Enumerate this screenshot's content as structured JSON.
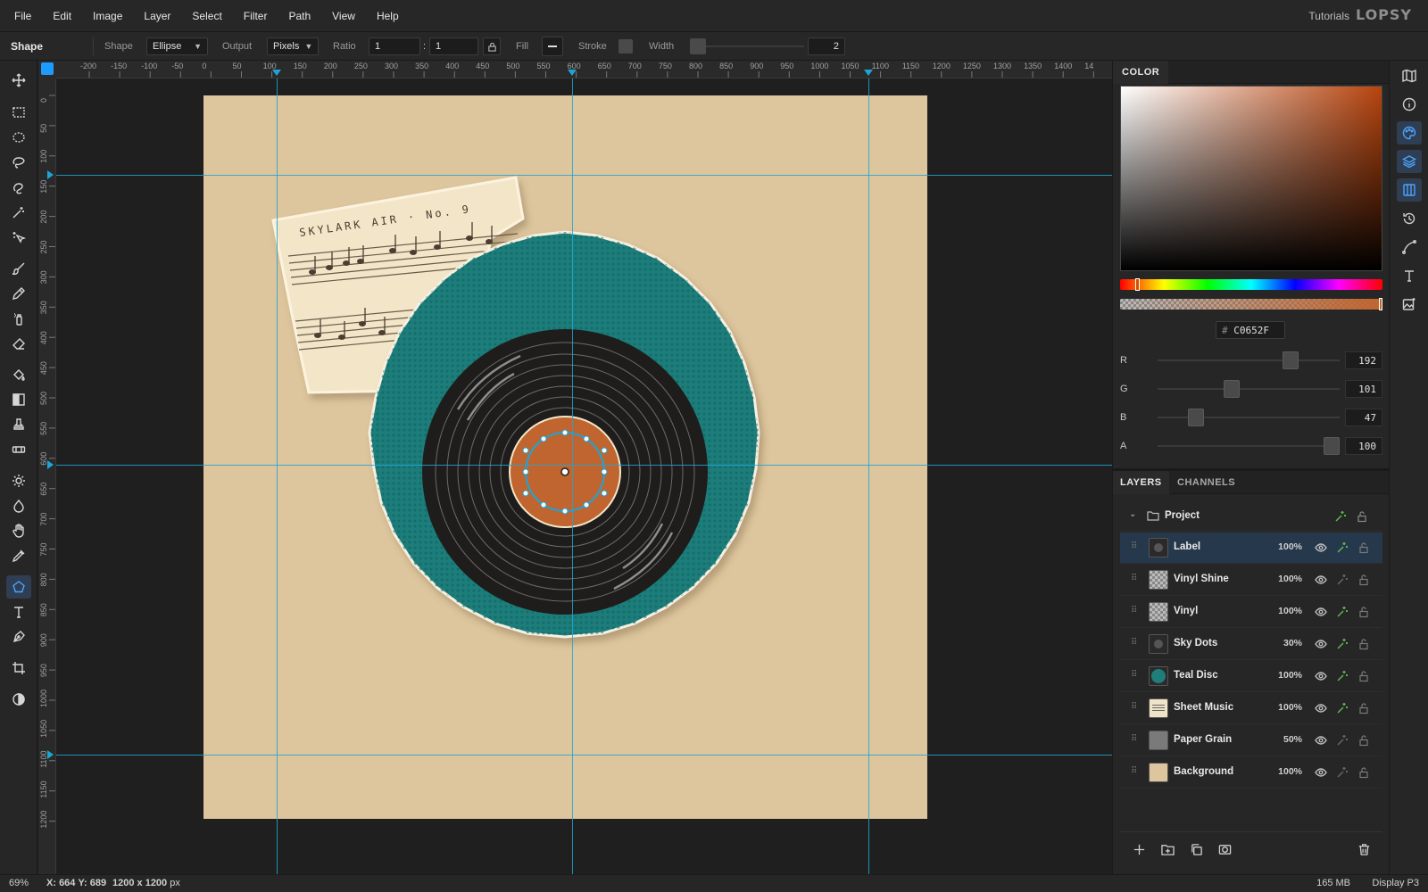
{
  "menubar": {
    "items": [
      "File",
      "Edit",
      "Image",
      "Layer",
      "Select",
      "Filter",
      "Path",
      "View",
      "Help"
    ],
    "tutorials": "Tutorials",
    "logo": "LOPSY"
  },
  "options": {
    "tool_name": "Shape",
    "shape_label": "Shape",
    "shape_value": "Ellipse",
    "output_label": "Output",
    "output_value": "Pixels",
    "ratio_label": "Ratio",
    "ratio_a": "1",
    "ratio_sep": ":",
    "ratio_b": "1",
    "fill_label": "Fill",
    "stroke_label": "Stroke",
    "width_label": "Width",
    "width_value": "2"
  },
  "ruler": {
    "top_ticks": [
      "-200",
      "-150",
      "-100",
      "-50",
      "0",
      "50",
      "100",
      "150",
      "200",
      "250",
      "300",
      "350",
      "400",
      "450",
      "500",
      "550",
      "600",
      "650",
      "700",
      "750",
      "800",
      "850",
      "900",
      "950",
      "1000",
      "1050",
      "1100",
      "1150",
      "1200",
      "1250",
      "1300",
      "1350",
      "1400",
      "14"
    ],
    "left_ticks": [
      "0",
      "50",
      "100",
      "150",
      "200",
      "250",
      "300",
      "350",
      "400",
      "450",
      "500",
      "550",
      "600",
      "650",
      "700",
      "750",
      "800",
      "850",
      "900",
      "950",
      "1000",
      "1050",
      "1100",
      "1150",
      "1200"
    ]
  },
  "artwork": {
    "sheet_title": "SKYLARK AIR · No. 9"
  },
  "color_panel": {
    "tab": "COLOR",
    "hex_prefix": "#",
    "hex": "C0652F",
    "channels": [
      {
        "label": "R",
        "value": "192",
        "level": 0.753
      },
      {
        "label": "G",
        "value": "101",
        "level": 0.396
      },
      {
        "label": "B",
        "value": "47",
        "level": 0.184
      },
      {
        "label": "A",
        "value": "100",
        "level": 1.0
      }
    ],
    "current_color": "#c0652f"
  },
  "layers_panel": {
    "tabs": [
      "LAYERS",
      "CHANNELS"
    ],
    "group": "Project",
    "layers": [
      {
        "name": "Label",
        "opacity": "100%",
        "selected": true,
        "thumb": "dark"
      },
      {
        "name": "Vinyl Shine",
        "opacity": "100%",
        "thumb": "checker"
      },
      {
        "name": "Vinyl",
        "opacity": "100%",
        "thumb": "checker"
      },
      {
        "name": "Sky Dots",
        "opacity": "30%",
        "thumb": "dark"
      },
      {
        "name": "Teal Disc",
        "opacity": "100%",
        "thumb": "teal"
      },
      {
        "name": "Sheet Music",
        "opacity": "100%",
        "thumb": "paper"
      },
      {
        "name": "Paper Grain",
        "opacity": "50%",
        "thumb": "grey"
      },
      {
        "name": "Background",
        "opacity": "100%",
        "thumb": "beige"
      }
    ]
  },
  "status": {
    "zoom": "69%",
    "coords_x_label": "X:",
    "coords_x": "664",
    "coords_y_label": "Y:",
    "coords_y": "689",
    "doc_size": "1200 x 1200",
    "doc_unit": "px",
    "memory": "165 MB",
    "color_profile": "Display P3"
  },
  "colors": {
    "accent": "#4aa3ff",
    "guide": "#1ea4d6",
    "canvas_bg": "#ddc59d",
    "teal": "#1f7d7a",
    "label_orange": "#c0652f",
    "vinyl": "#1e1e1e",
    "lock_green": "#5fbf4f"
  }
}
